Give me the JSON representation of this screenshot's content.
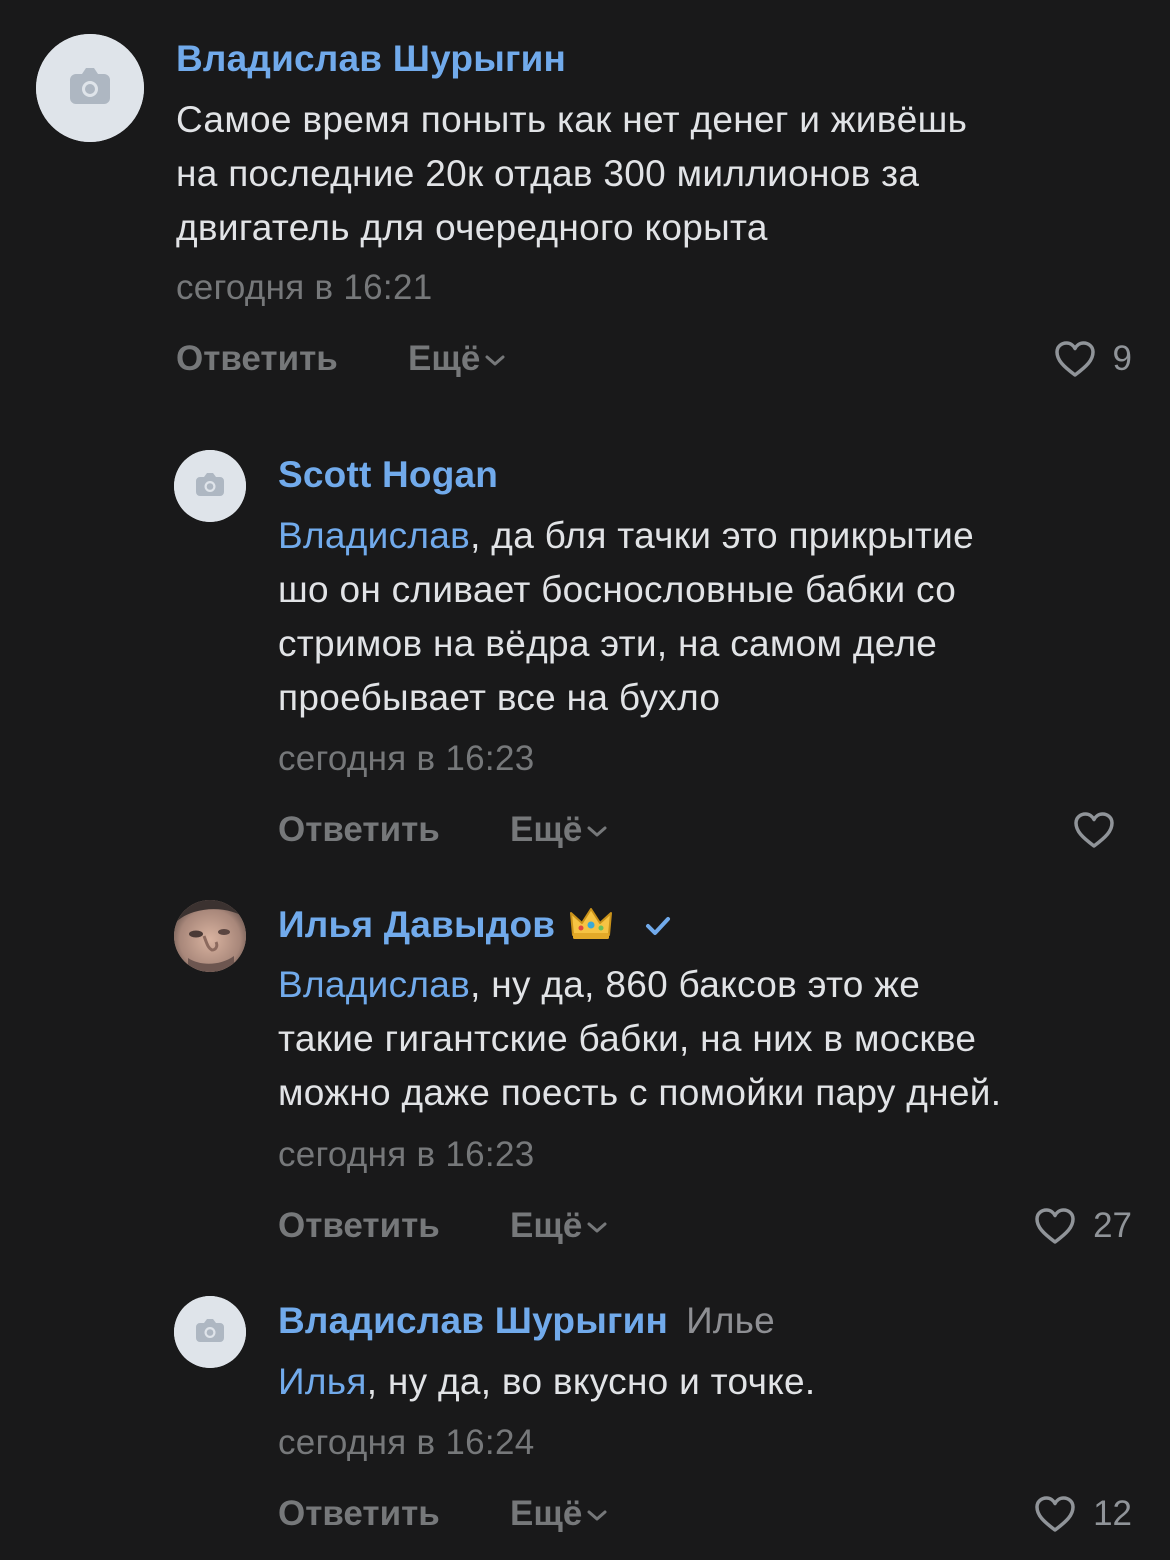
{
  "comments": [
    {
      "author": "Владислав Шурыгин",
      "reply_to": "",
      "mention": "",
      "lines": [
        "Самое время поныть как нет денег и живёшь",
        "на последние 20к отдав 300 миллионов за",
        "двигатель для очередного корыта"
      ],
      "time": "сегодня в 16:21",
      "reply_label": "Ответить",
      "more_label": "Ещё",
      "likes": "9",
      "avatar": "camera-placeholder"
    },
    {
      "author": "Scott Hogan",
      "reply_to": "",
      "mention": "Владислав",
      "lines": [
        ", да бля тачки это прикрытие",
        "шо он сливает боснословные бабки со",
        "стримов на вёдра эти, на самом деле",
        "проебывает все на бухло"
      ],
      "time": "сегодня в 16:23",
      "reply_label": "Ответить",
      "more_label": "Ещё",
      "likes": "",
      "avatar": "camera-placeholder"
    },
    {
      "author": "Илья Давыдов",
      "reply_to": "",
      "mention": "Владислав",
      "lines": [
        ", ну да, 860 баксов это же",
        "такие гигантские бабки, на них в москве",
        "можно даже поесть с помойки пару дней."
      ],
      "time": "сегодня в 16:23",
      "reply_label": "Ответить",
      "more_label": "Ещё",
      "likes": "27",
      "avatar": "user-photo",
      "badges": [
        "crown-emoji",
        "verified-check-icon"
      ]
    },
    {
      "author": "Владислав Шурыгин",
      "reply_to": "Илье",
      "mention": "Илья",
      "lines": [
        ", ну да, во вкусно и точке."
      ],
      "time": "сегодня в 16:24",
      "reply_label": "Ответить",
      "more_label": "Ещё",
      "likes": "12",
      "avatar": "camera-placeholder"
    }
  ],
  "colors": {
    "background": "#19191a",
    "link": "#71aaeb",
    "text": "#e1e3e6",
    "secondary": "#76787a"
  }
}
